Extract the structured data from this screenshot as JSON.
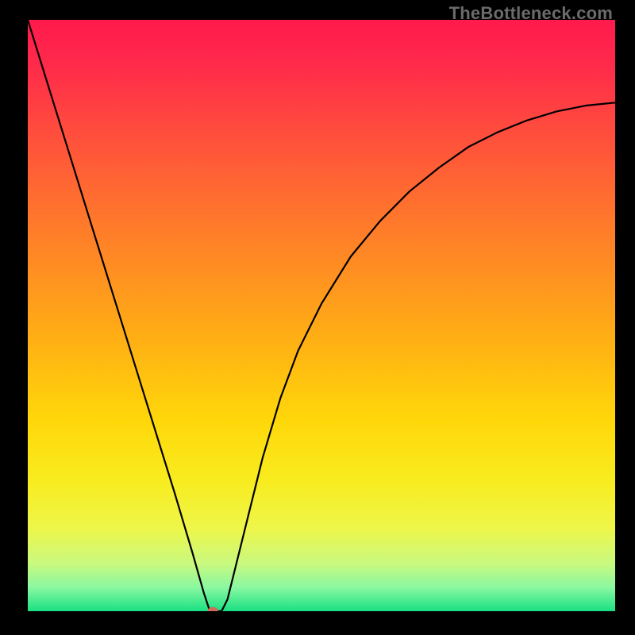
{
  "watermark": "TheBottleneck.com",
  "chart_data": {
    "type": "line",
    "title": "",
    "xlabel": "",
    "ylabel": "",
    "xlim": [
      0,
      100
    ],
    "ylim": [
      0,
      100
    ],
    "grid": false,
    "legend": false,
    "background_gradient": {
      "stops": [
        {
          "offset": 0.0,
          "color": "#ff1a4d"
        },
        {
          "offset": 0.08,
          "color": "#ff2b4a"
        },
        {
          "offset": 0.18,
          "color": "#ff4a3e"
        },
        {
          "offset": 0.3,
          "color": "#ff6d30"
        },
        {
          "offset": 0.42,
          "color": "#ff8e22"
        },
        {
          "offset": 0.55,
          "color": "#ffb213"
        },
        {
          "offset": 0.68,
          "color": "#ffd80a"
        },
        {
          "offset": 0.78,
          "color": "#f8ec1f"
        },
        {
          "offset": 0.86,
          "color": "#eef64a"
        },
        {
          "offset": 0.92,
          "color": "#c8f97f"
        },
        {
          "offset": 0.96,
          "color": "#8af8a1"
        },
        {
          "offset": 1.0,
          "color": "#19e083"
        }
      ]
    },
    "series": [
      {
        "name": "bottleneck-curve",
        "color": "#000000",
        "x": [
          0,
          5,
          10,
          15,
          20,
          25,
          28,
          30,
          31,
          32,
          33,
          34,
          36,
          38,
          40,
          43,
          46,
          50,
          55,
          60,
          65,
          70,
          75,
          80,
          85,
          90,
          95,
          100
        ],
        "values": [
          100,
          84,
          68,
          52,
          36,
          20,
          10,
          3,
          0,
          0,
          0,
          2,
          10,
          18,
          26,
          36,
          44,
          52,
          60,
          66,
          71,
          75,
          78.5,
          81,
          83,
          84.5,
          85.5,
          86
        ]
      }
    ],
    "marker": {
      "x": 31.5,
      "y": 0,
      "rx": 0.9,
      "ry": 0.7,
      "color": "#d06a5a"
    }
  }
}
